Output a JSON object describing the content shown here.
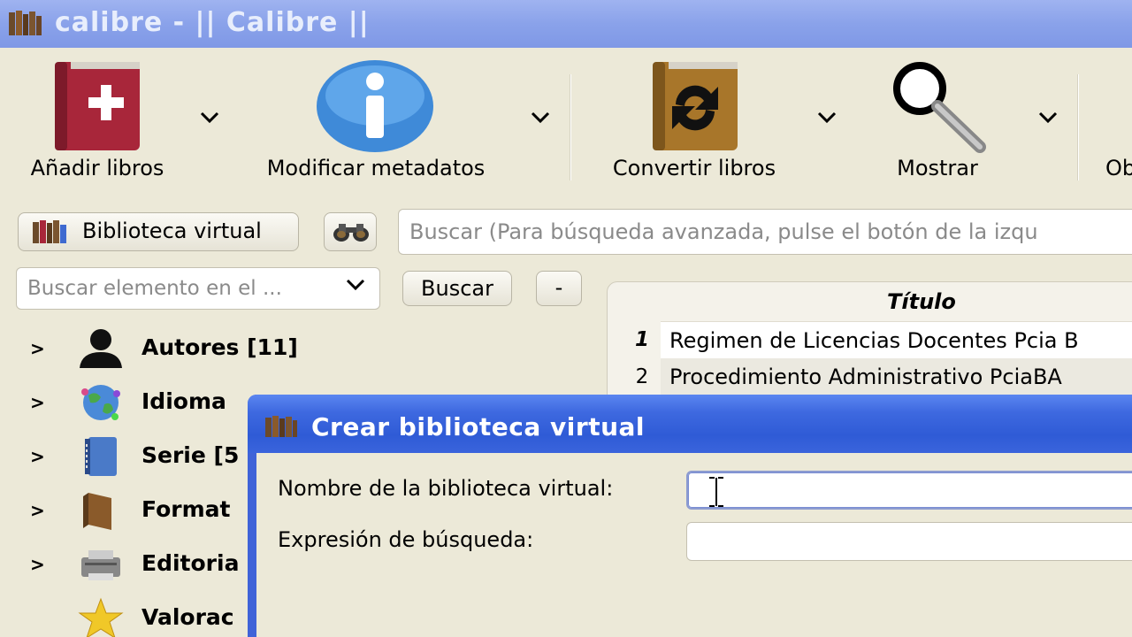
{
  "window": {
    "title": "calibre - || Calibre ||"
  },
  "toolbar": {
    "add_books": "Añadir libros",
    "edit_metadata": "Modificar metadatos",
    "convert_books": "Convertir libros",
    "view": "Mostrar",
    "partial_next": "Ob"
  },
  "search_row": {
    "virtual_library_label": "Biblioteca virtual",
    "search_placeholder": "Buscar (Para búsqueda avanzada, pulse el botón de la izqu"
  },
  "tag_browser": {
    "find_placeholder": "Buscar elemento en el ...",
    "find_button": "Buscar",
    "collapse_button": "-",
    "items": [
      {
        "label": "Autores [11]",
        "icon": "user-icon"
      },
      {
        "label": "Idioma",
        "icon": "globe-icon"
      },
      {
        "label": "Serie [5",
        "icon": "series-icon"
      },
      {
        "label": "Format",
        "icon": "book-icon"
      },
      {
        "label": "Editoria",
        "icon": "printer-icon"
      },
      {
        "label": "Valorac",
        "icon": "star-icon"
      }
    ]
  },
  "book_list": {
    "column_title": "Título",
    "rows": [
      {
        "num": "1",
        "title": "Regimen de Licencias Docentes Pcia B"
      },
      {
        "num": "2",
        "title": "Procedimiento Administrativo PciaBA"
      }
    ]
  },
  "dialog": {
    "title": "Crear biblioteca virtual",
    "name_label": "Nombre de la biblioteca virtual:",
    "name_value": "",
    "search_label": "Expresión de búsqueda:",
    "search_value": ""
  },
  "colors": {
    "titlebar": "#8aa2ea",
    "dialog_titlebar": "#2f5bd6",
    "window_bg": "#ece9d8"
  }
}
